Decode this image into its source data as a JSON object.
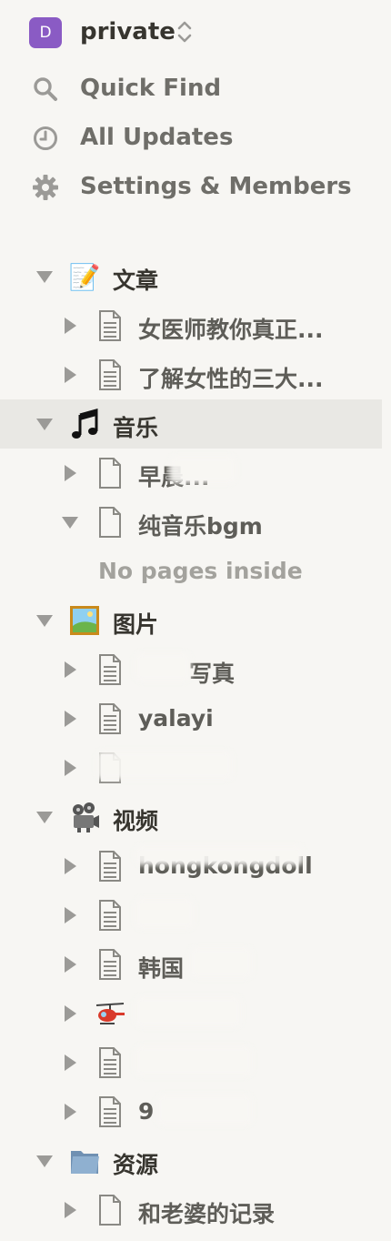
{
  "workspace": {
    "avatar_letter": "D",
    "name": "private",
    "accent": "#8a5bc4"
  },
  "nav": [
    {
      "label": "Quick Find",
      "icon": "search-icon"
    },
    {
      "label": "All Updates",
      "icon": "clock-icon"
    },
    {
      "label": "Settings & Members",
      "icon": "gear-icon"
    }
  ],
  "tree": {
    "wenzhang": {
      "label": "文章",
      "icon": "memo-icon"
    },
    "w1": {
      "label": "女医师教你真正..."
    },
    "w2": {
      "label": "了解女性的三大..."
    },
    "yinyue": {
      "label": "音乐",
      "icon": "music-notes-icon"
    },
    "y1": {
      "label": "早晨..."
    },
    "y2": {
      "label": "纯音乐bgm"
    },
    "y2_empty": "No pages inside",
    "tupian": {
      "label": "图片",
      "icon": "framed-picture-icon"
    },
    "t1": {
      "label": "写真"
    },
    "t2": {
      "label": "yalayi"
    },
    "t3": {
      "label": ""
    },
    "shipin": {
      "label": "视频",
      "icon": "film-projector-icon"
    },
    "s1": {
      "label": "hongkongdoll"
    },
    "s2": {
      "label": ""
    },
    "s3": {
      "label": "韩国"
    },
    "s4": {
      "label": "",
      "icon": "helicopter-icon"
    },
    "s5": {
      "label": ""
    },
    "s6": {
      "label": "9"
    },
    "ziyuan": {
      "label": "资源",
      "icon": "folder-icon"
    },
    "z1": {
      "label": "和老婆的记录"
    }
  }
}
